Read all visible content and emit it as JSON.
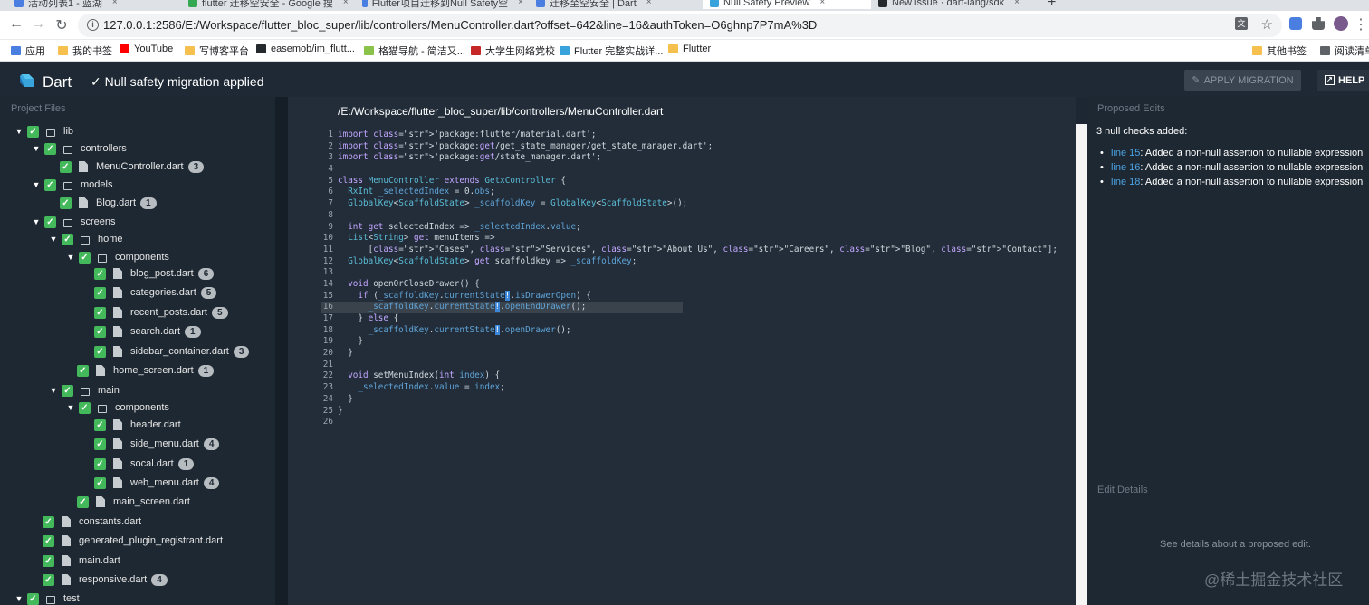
{
  "browser": {
    "tabs": [
      {
        "label": "活动列表1 - 蓝湖",
        "icon": "blue"
      },
      {
        "label": "flutter 迁移空安全 - Google 搜",
        "icon": "google"
      },
      {
        "label": "Flutter项目迁移到Null Safety空",
        "icon": "blue"
      },
      {
        "label": "迁移至空安全 | Dart",
        "icon": "blue"
      },
      {
        "label": "Null Safety Preview",
        "icon": "dart",
        "active": true
      },
      {
        "label": "New issue · dart-lang/sdk",
        "icon": "github"
      }
    ],
    "url": "127.0.0.1:2586/E:/Workspace/flutter_bloc_super/lib/controllers/MenuController.dart?offset=642&line=16&authToken=O6ghnp7P7mA%3D",
    "bookmarks": [
      "应用",
      "我的书签",
      "YouTube",
      "写博客平台",
      "easemob/im_flutt...",
      "格猫导航 - 简洁又...",
      "大学生网络党校",
      "Flutter 完整实战详...",
      "Flutter"
    ],
    "bookmarks_right": [
      "其他书签",
      "阅读清单"
    ]
  },
  "header": {
    "app_name": "Dart",
    "status": "✓ Null safety migration applied",
    "apply_label": "APPLY MIGRATION",
    "help_label": "HELP"
  },
  "sidebar": {
    "heading": "Project Files",
    "tree": [
      {
        "depth": 0,
        "kind": "folder",
        "name": "lib",
        "expanded": true
      },
      {
        "depth": 1,
        "kind": "folder",
        "name": "controllers",
        "expanded": true
      },
      {
        "depth": 2,
        "kind": "file",
        "name": "MenuController.dart",
        "count": "3"
      },
      {
        "depth": 1,
        "kind": "folder",
        "name": "models",
        "expanded": true
      },
      {
        "depth": 2,
        "kind": "file",
        "name": "Blog.dart",
        "count": "1"
      },
      {
        "depth": 1,
        "kind": "folder",
        "name": "screens",
        "expanded": true
      },
      {
        "depth": 2,
        "kind": "folder",
        "name": "home",
        "expanded": true
      },
      {
        "depth": 3,
        "kind": "folder",
        "name": "components",
        "expanded": true
      },
      {
        "depth": 4,
        "kind": "file",
        "name": "blog_post.dart",
        "count": "6"
      },
      {
        "depth": 4,
        "kind": "file",
        "name": "categories.dart",
        "count": "5"
      },
      {
        "depth": 4,
        "kind": "file",
        "name": "recent_posts.dart",
        "count": "5"
      },
      {
        "depth": 4,
        "kind": "file",
        "name": "search.dart",
        "count": "1"
      },
      {
        "depth": 4,
        "kind": "file",
        "name": "sidebar_container.dart",
        "count": "3"
      },
      {
        "depth": 3,
        "kind": "file",
        "name": "home_screen.dart",
        "count": "1"
      },
      {
        "depth": 2,
        "kind": "folder",
        "name": "main",
        "expanded": true
      },
      {
        "depth": 3,
        "kind": "folder",
        "name": "components",
        "expanded": true
      },
      {
        "depth": 4,
        "kind": "file",
        "name": "header.dart"
      },
      {
        "depth": 4,
        "kind": "file",
        "name": "side_menu.dart",
        "count": "4"
      },
      {
        "depth": 4,
        "kind": "file",
        "name": "socal.dart",
        "count": "1"
      },
      {
        "depth": 4,
        "kind": "file",
        "name": "web_menu.dart",
        "count": "4"
      },
      {
        "depth": 3,
        "kind": "file",
        "name": "main_screen.dart"
      },
      {
        "depth": 1,
        "kind": "file",
        "name": "constants.dart"
      },
      {
        "depth": 1,
        "kind": "file",
        "name": "generated_plugin_registrant.dart"
      },
      {
        "depth": 1,
        "kind": "file",
        "name": "main.dart"
      },
      {
        "depth": 1,
        "kind": "file",
        "name": "responsive.dart",
        "count": "4"
      },
      {
        "depth": 0,
        "kind": "folder",
        "name": "test",
        "expanded": true
      }
    ]
  },
  "editor": {
    "path": "/E:/Workspace/flutter_bloc_super/lib/controllers/MenuController.dart",
    "highlight_line": 16,
    "lines": [
      "import 'package:flutter/material.dart';",
      "import 'package:get/get_state_manager/get_state_manager.dart';",
      "import 'package:get/state_manager.dart';",
      "",
      "class MenuController extends GetxController {",
      "  RxInt _selectedIndex = 0.obs;",
      "  GlobalKey<ScaffoldState> _scaffoldKey = GlobalKey<ScaffoldState>();",
      "",
      "  int get selectedIndex => _selectedIndex.value;",
      "  List<String> get menuItems =>",
      "      [\"Cases\", \"Services\", \"About Us\", \"Careers\", \"Blog\", \"Contact\"];",
      "  GlobalKey<ScaffoldState> get scaffoldkey => _scaffoldKey;",
      "",
      "  void openOrCloseDrawer() {",
      "    if (_scaffoldKey.currentState!.isDrawerOpen) {",
      "      _scaffoldKey.currentState!.openEndDrawer();",
      "    } else {",
      "      _scaffoldKey.currentState!.openDrawer();",
      "    }",
      "  }",
      "",
      "  void setMenuIndex(int index) {",
      "    _selectedIndex.value = index;",
      "  }",
      "}",
      ""
    ]
  },
  "proposed": {
    "heading": "Proposed Edits",
    "summary": "3 null checks added:",
    "edits": [
      {
        "link": "line 15",
        "text": ": Added a non-null assertion to nullable expression"
      },
      {
        "link": "line 16",
        "text": ": Added a non-null assertion to nullable expression"
      },
      {
        "link": "line 18",
        "text": ": Added a non-null assertion to nullable expression"
      }
    ]
  },
  "details": {
    "heading": "Edit Details",
    "note": "See details about a proposed edit."
  },
  "watermark": "@稀土掘金技术社区",
  "colors": {
    "check": "#44b95b",
    "link": "#4aa3e4",
    "bang": "#3b86d8"
  }
}
